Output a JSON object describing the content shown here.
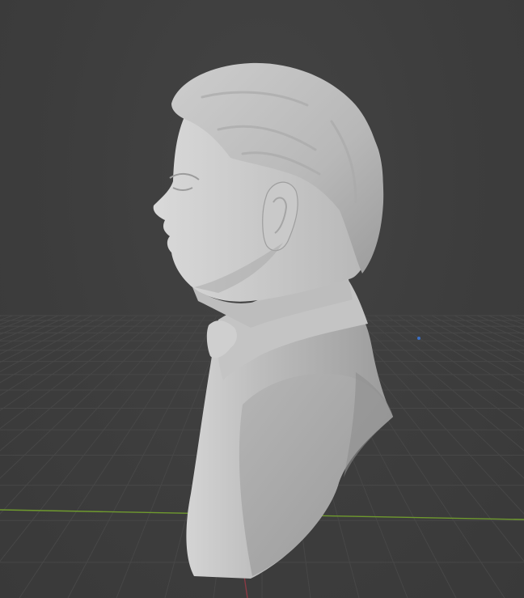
{
  "app": "3D viewport",
  "scene": {
    "object": "bust-sculpt",
    "view": "side-profile",
    "shading": "solid",
    "grid": true,
    "axes_visible": [
      "x",
      "y",
      "z"
    ]
  },
  "colors": {
    "background": "#3d3d3d",
    "grid_line": "#474747",
    "x_axis": "#8a3a44",
    "y_axis": "#6f9a2e",
    "z_axis": "#3a6fc4",
    "mesh": "#b9b9b9",
    "mesh_shadow": "#8e8e8e"
  }
}
